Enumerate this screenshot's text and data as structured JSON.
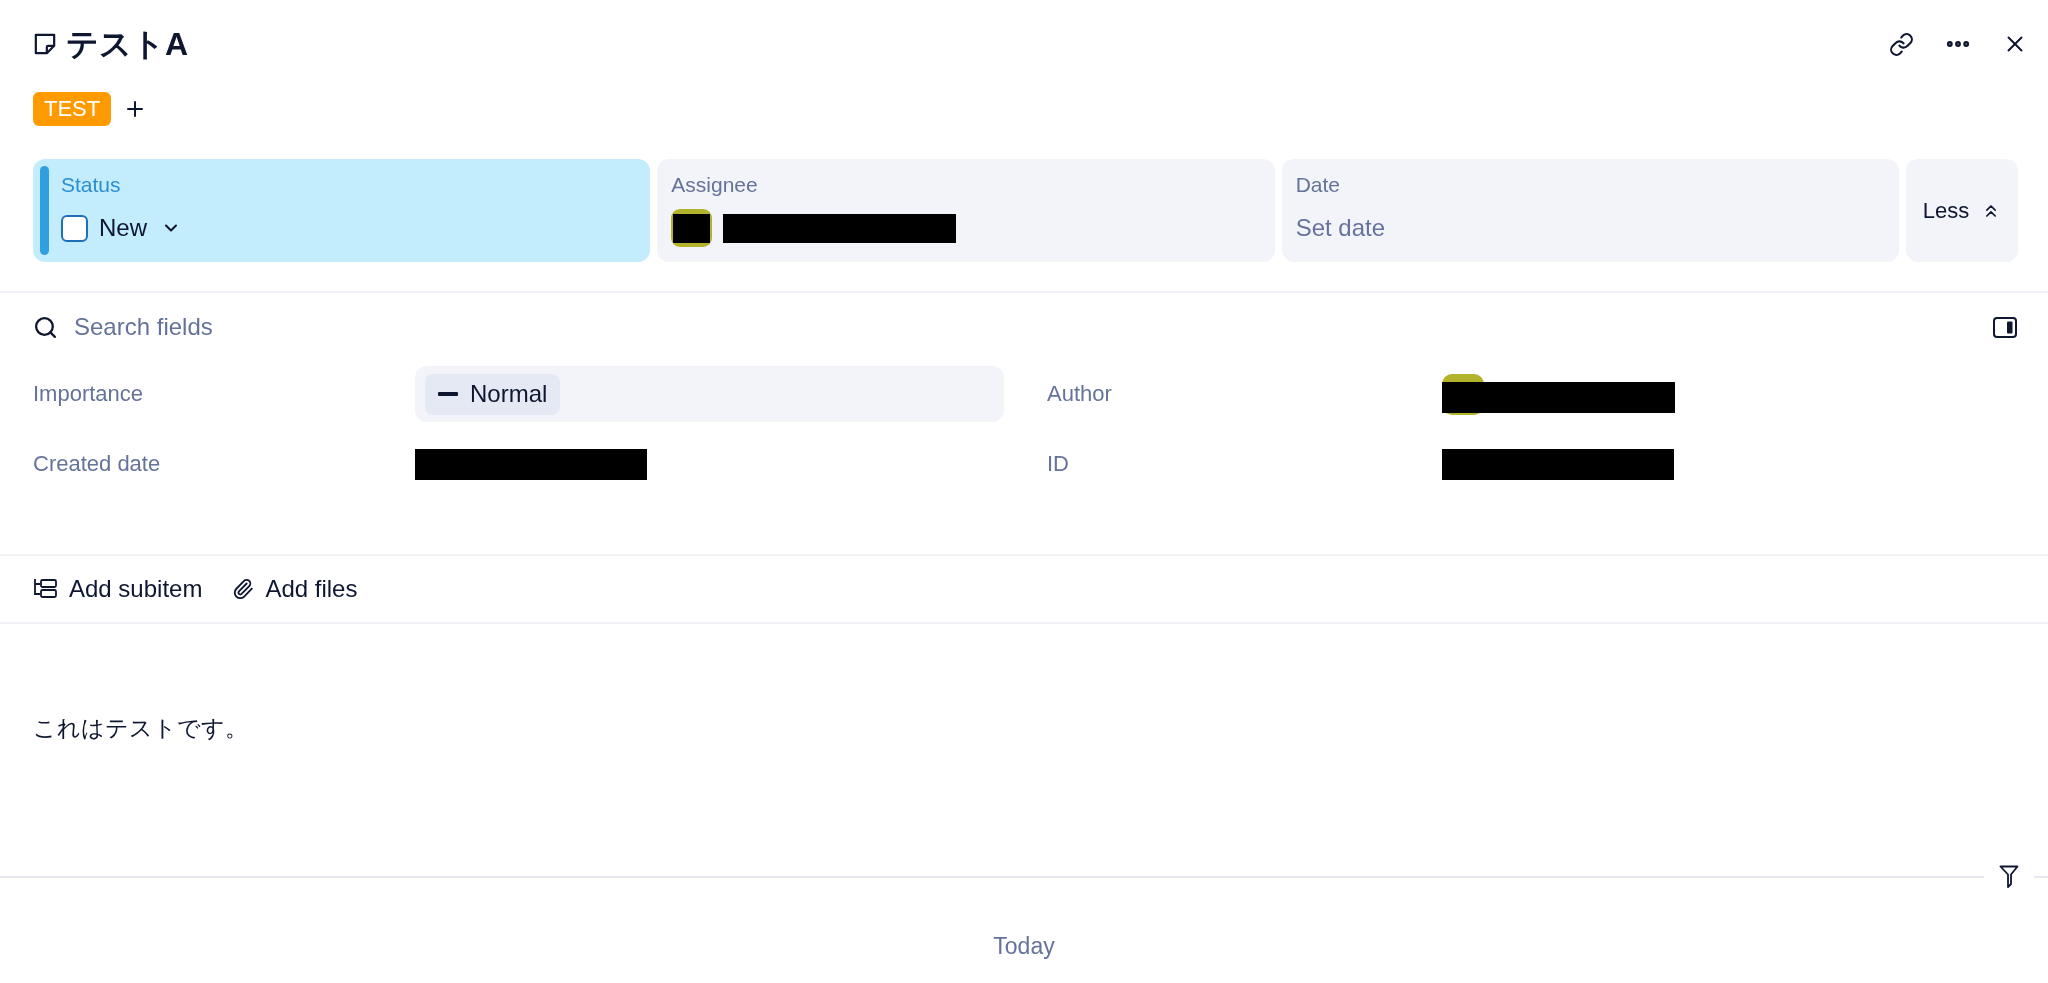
{
  "header": {
    "title": "テストA",
    "tags": [
      {
        "label": "TEST",
        "color": "#ff9a00"
      }
    ]
  },
  "fields": [
    {
      "kind": "status",
      "label": "Status",
      "value": "New",
      "checked": false,
      "selected": true
    },
    {
      "kind": "person",
      "label": "Assignee",
      "selected": false
    },
    {
      "kind": "date",
      "label": "Date",
      "placeholder": "Set date",
      "selected": false
    }
  ],
  "toggle": {
    "label": "Less",
    "expanded": true
  },
  "details": {
    "search": {
      "placeholder": "Search fields"
    },
    "properties": [
      {
        "label": "Importance",
        "kind": "chip",
        "value": "Normal"
      },
      {
        "label": "Author",
        "kind": "person"
      },
      {
        "label": "Created date",
        "kind": "redacted"
      },
      {
        "label": "ID",
        "kind": "redacted"
      }
    ]
  },
  "actions": [
    {
      "kind": "subitem",
      "label": "Add subitem"
    },
    {
      "kind": "attach",
      "label": "Add files"
    }
  ],
  "description": "これはテストです。",
  "activity": {
    "date_label": "Today"
  }
}
